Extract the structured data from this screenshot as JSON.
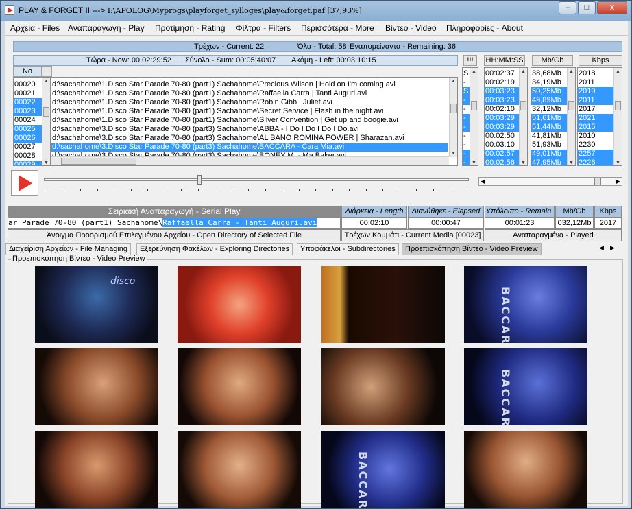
{
  "window": {
    "title_prefix": "PLAY & FORGET II ---> ",
    "title_path": "I:\\APOLOG\\Myprogs\\playforget_sylloges\\play&forget.paf [37,93%]",
    "min": "–",
    "max": "□",
    "close": "x"
  },
  "menu": [
    "Αρχεία - Files",
    "Αναπαραγωγή - Play",
    "Προτίμηση - Rating",
    "Φίλτρα - Filters",
    "Περισσότερα - More",
    "Βίντεο - Video",
    "Πληροφορίες - About"
  ],
  "status1": {
    "current": "Τρέχων - Current: 22",
    "total": "Όλα - Total: 58",
    "remaining": "Εναπομείναντα - Remaining: 36"
  },
  "status2": {
    "now": "Τώρα - Now:  00:02:29:52",
    "sum": "Σύνολο - Sum:  00:05:40:07",
    "left": "Ακόμη - Left:  00:03:10:15"
  },
  "columns": {
    "no": "No",
    "flag": "!!!",
    "time": "HH:MM:SS",
    "size": "Mb/Gb",
    "kbps": "Kbps"
  },
  "rows": [
    {
      "no": "00020",
      "path": "d:\\sachahome\\1.Disco Star Parade 70-80  (part1) Sachahome\\Precious Wilson | Hold on I'm coming.avi",
      "flag": "S",
      "time": "00:02:37",
      "size": "38,68Mb",
      "kbps": "2018",
      "sel": false
    },
    {
      "no": "00021",
      "path": "d:\\sachahome\\1.Disco Star Parade 70-80  (part1) Sachahome\\Raffaella Carra | Tanti Auguri.avi",
      "flag": "-",
      "time": "00:02:19",
      "size": "34,19Mb",
      "kbps": "2011",
      "sel": false
    },
    {
      "no": "00022",
      "path": "d:\\sachahome\\1.Disco Star Parade 70-80  (part1) Sachahome\\Robin Gibb | Juliet.avi",
      "flag": "S",
      "time": "00:03:23",
      "size": "50,25Mb",
      "kbps": "2019",
      "sel": true
    },
    {
      "no": "00023",
      "path": "d:\\sachahome\\1.Disco Star Parade 70-80  (part1) Sachahome\\Secret Service | Flash in the night.avi",
      "flag": "-",
      "time": "00:03:23",
      "size": "49,89Mb",
      "kbps": "2011",
      "sel": true
    },
    {
      "no": "00024",
      "path": "d:\\sachahome\\1.Disco Star Parade 70-80  (part1) Sachahome\\Silver Convention | Get up and boogie.avi",
      "flag": "-",
      "time": "00:02:10",
      "size": "32,12Mb",
      "kbps": "2017",
      "sel": false
    },
    {
      "no": "00025",
      "path": "d:\\sachahome\\3.Disco Star Parade 70-80  (part3) Sachahome\\ABBA - I Do I Do I Do I Do.avi",
      "flag": "-",
      "time": "00:03:29",
      "size": "51,61Mb",
      "kbps": "2021",
      "sel": true
    },
    {
      "no": "00026",
      "path": "d:\\sachahome\\3.Disco Star Parade 70-80  (part3) Sachahome\\AL BANO ROMINA POWER | Sharazan.avi",
      "flag": "-",
      "time": "00:03:29",
      "size": "51,44Mb",
      "kbps": "2015",
      "sel": true
    },
    {
      "no": "00027",
      "path": "d:\\sachahome\\3.Disco Star Parade 70-80  (part3) Sachahome\\BACCARA - Cara Mia.avi",
      "flag": "-",
      "time": "00:02:50",
      "size": "41,81Mb",
      "kbps": "2010",
      "sel": false
    },
    {
      "no": "00028",
      "path": "d:\\sachahome\\3.Disco Star Parade 70-80  (part3) Sachahome\\BONEY M. - Ma Baker.avi",
      "flag": "-",
      "time": "00:03:10",
      "size": "51,93Mb",
      "kbps": "2230",
      "sel": false
    },
    {
      "no": "00029",
      "path": "",
      "flag": "-",
      "time": "00:02:57",
      "size": "49,01Mb",
      "kbps": "2257",
      "sel": true
    },
    {
      "no": "",
      "path": "",
      "flag": "-",
      "time": "00:02:56",
      "size": "47,95Mb",
      "kbps": "2226",
      "sel": true
    }
  ],
  "path_selected_index": 7,
  "serial_play": {
    "title": "Σειριακή Αναπαραγωγή - Serial Play",
    "marquee_plain": "ar Parade 70-80  (part1) Sachahome\\",
    "marquee_highlight": "Raffaella Carra - Tanti Auguri.avi"
  },
  "info": {
    "length_h": "Διάρκεια - Length",
    "elapsed_h": "Διανύθηκε - Elapsed",
    "remain_h": "Υπόλοιπο - Remain.",
    "size_h": "Mb/Gb",
    "kbps_h": "Kbps",
    "length": "00:02:10",
    "elapsed": "00:00:47",
    "remain": "00:01:23",
    "size": "032,12Mb",
    "kbps": "2017"
  },
  "buttons": {
    "open_dir": "Άνοιγμα Προορισμού Επιλεγμένου Αρχείου - Open Directory of Selected File",
    "current_media": "Τρέχων Κομμάτι - Current Media [00023]",
    "played": "Αναπαραγμένα - Played"
  },
  "tabs": [
    "Διαχείριση Αρχείων - File Managing",
    "Εξερεύνηση Φακέλων - Exploring Directories",
    "Υποφάκελοι - Subdirectories",
    "Προεπισκόπηση Βίντεο - Video Preview"
  ],
  "preview_title": "Προεπισκόπηση Βίντεο -  Video Preview",
  "thumb_text": [
    "disco",
    "BACCARA",
    "BACCARA",
    "BACCARA",
    "BACCARA"
  ]
}
